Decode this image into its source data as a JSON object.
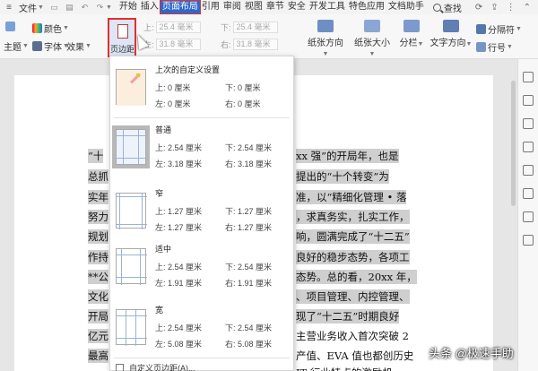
{
  "menubar": {
    "file": "文件",
    "tabs": [
      "开始",
      "插入",
      "页面布局",
      "引用",
      "审阅",
      "视图",
      "章节",
      "安全",
      "开发工具",
      "特色应用",
      "文档助手"
    ],
    "active_tab": "页面布局",
    "search": "查找",
    "accent": "#2f68c9"
  },
  "ribbon": {
    "theme": "主题",
    "color": "颜色",
    "font": "字体",
    "effect": "效果",
    "margin": "页边距",
    "top_label": "上:",
    "top_value": "25.4 毫米",
    "bottom_label": "下:",
    "bottom_value": "25.4 毫米",
    "left_label": "左:",
    "left_value": "31.8 毫米",
    "right_label": "右:",
    "right_value": "31.8 毫米",
    "orientation": "纸张方向",
    "size": "纸张大小",
    "columns": "分栏",
    "text_direction": "文字方向",
    "separator": "分隔符",
    "line_number": "行号"
  },
  "margins_menu": {
    "items": [
      {
        "title": "上次的自定义设置",
        "top": "上: 0 厘米",
        "bottom": "下: 0 厘米",
        "left": "左: 0 厘米",
        "right": "右: 0 厘米"
      },
      {
        "title": "普通",
        "top": "上: 2.54 厘米",
        "bottom": "下: 2.54 厘米",
        "left": "左: 3.18 厘米",
        "right": "右: 3.18 厘米"
      },
      {
        "title": "窄",
        "top": "上: 1.27 厘米",
        "bottom": "下: 1.27 厘米",
        "left": "左: 1.27 厘米",
        "right": "右: 1.27 厘米"
      },
      {
        "title": "适中",
        "top": "上: 2.54 厘米",
        "bottom": "下: 2.54 厘米",
        "left": "左: 1.91 厘米",
        "right": "右: 1.91 厘米"
      },
      {
        "title": "宽",
        "top": "上: 2.54 厘米",
        "bottom": "下: 2.54 厘米",
        "left": "左: 5.08 厘米",
        "right": "右: 5.08 厘米"
      }
    ],
    "custom": "自定义页边距(A)..."
  },
  "document": {
    "left_lines": [
      "“十",
      "总抓",
      "实年",
      "努力",
      "规划",
      "作持",
      "**公",
      "文化",
      "开局",
      "亿元",
      "最高"
    ],
    "right_lines": [
      "xx 强”的开局年，也是",
      "提出的“十个转变”为",
      "准，以“精细化管理 • 落",
      "，求真务实，扎实工作，",
      "响，圆满完成了“十二五”",
      "良好的稳步态势，各项工",
      "态势。总的看，20xx 年，",
      "、项目管理、内控管理、",
      "现了“十二五”时期良好",
      "主营业务收入首次突破 2",
      "产值、EVA 值也都创历史",
      "IT 行业特点的激励机"
    ]
  },
  "watermark": "头条 @极速手助"
}
